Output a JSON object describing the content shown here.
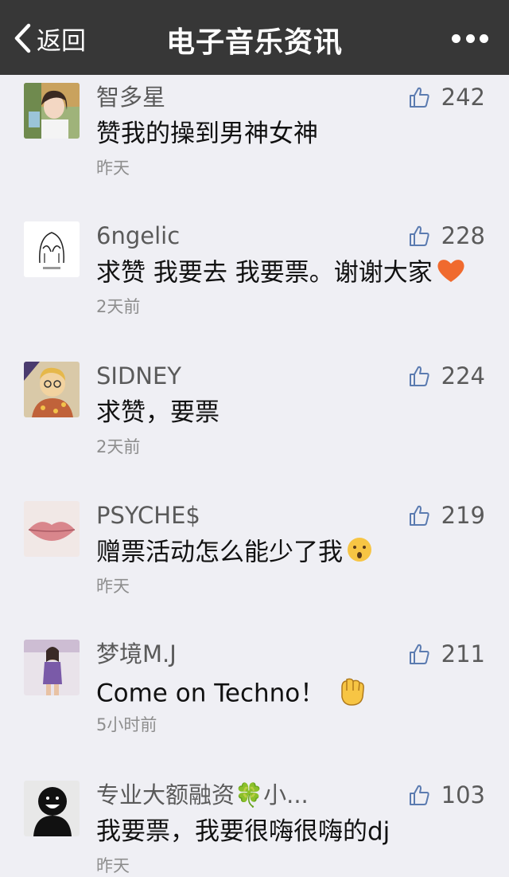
{
  "navbar": {
    "back_label": "返回",
    "title": "电子音乐资讯",
    "bg_color": "#373737"
  },
  "comments": [
    {
      "nickname": "智多星",
      "content": "赞我的操到男神女神",
      "time": "昨天",
      "likes": "242",
      "avatar": "girl-photo"
    },
    {
      "nickname": "6ngelic",
      "content": "求赞 我要去  我要票。谢谢大家",
      "time": "2天前",
      "likes": "228",
      "avatar": "no-look-sketch",
      "emoji": "orange-heart"
    },
    {
      "nickname": "SIDNEY",
      "content": "求赞，要票",
      "time": "2天前",
      "likes": "224",
      "avatar": "cartoon-man"
    },
    {
      "nickname": "PSYCHE$",
      "content": "赠票活动怎么能少了我",
      "time": "昨天",
      "likes": "219",
      "avatar": "lips-photo",
      "emoji": "hushed-face"
    },
    {
      "nickname": "梦境M.J",
      "content": "Come on Techno！",
      "time": "5小时前",
      "likes": "211",
      "avatar": "woman-photo",
      "emoji": "raised-fist"
    },
    {
      "nickname": "专业大额融资🍀小...",
      "content": "我要票，我要很嗨很嗨的dj",
      "time": "昨天",
      "likes": "103",
      "avatar": "smiling-shadow"
    }
  ]
}
